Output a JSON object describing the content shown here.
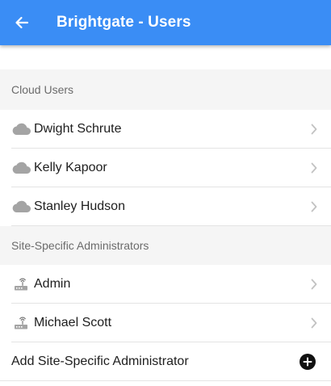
{
  "header": {
    "title": "Brightgate - Users",
    "back_icon": "arrow-left-icon",
    "background_color": "#3a8df5"
  },
  "sections": {
    "cloud_users": {
      "title": "Cloud Users",
      "icon": "cloud-icon",
      "items": [
        {
          "name": "Dwight Schrute"
        },
        {
          "name": "Kelly Kapoor"
        },
        {
          "name": "Stanley Hudson"
        }
      ]
    },
    "site_admins": {
      "title": "Site-Specific Administrators",
      "icon": "router-icon",
      "items": [
        {
          "name": "Admin"
        },
        {
          "name": "Michael Scott"
        }
      ],
      "add_label": "Add Site-Specific Administrator",
      "add_icon": "plus-circle-icon"
    }
  }
}
